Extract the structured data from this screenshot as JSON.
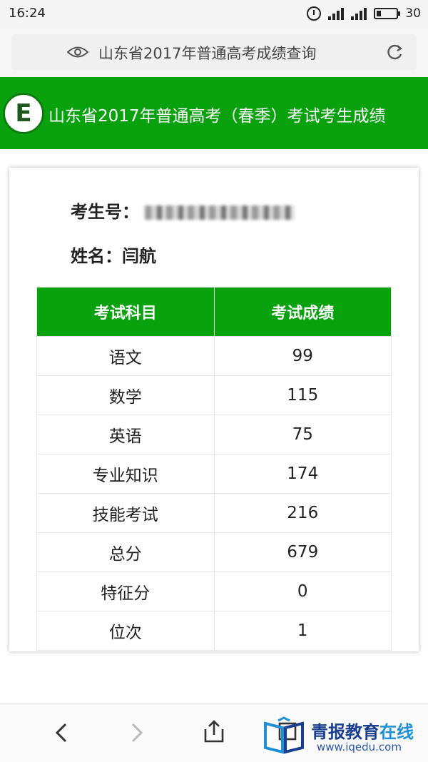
{
  "status_bar": {
    "time": "16:24",
    "battery": "30"
  },
  "browser": {
    "page_title": "山东省2017年普通高考成绩查询"
  },
  "header": {
    "logo_letter": "E",
    "title": "山东省2017年普通高考（春季）考试考生成绩"
  },
  "student": {
    "exam_no_label": "考生号：",
    "name_label": "姓名：",
    "name": "闫航"
  },
  "table": {
    "headers": [
      "考试科目",
      "考试成绩"
    ],
    "rows": [
      {
        "subject": "语文",
        "score": "99"
      },
      {
        "subject": "数学",
        "score": "115"
      },
      {
        "subject": "英语",
        "score": "75"
      },
      {
        "subject": "专业知识",
        "score": "174"
      },
      {
        "subject": "技能考试",
        "score": "216"
      },
      {
        "subject": "总分",
        "score": "679"
      },
      {
        "subject": "特征分",
        "score": "0"
      },
      {
        "subject": "位次",
        "score": "1"
      }
    ]
  },
  "watermark": {
    "name_part1": "青报教育",
    "name_part2": "在线",
    "url": "www.iqedu.com"
  },
  "colors": {
    "header_green": "#0aa10f",
    "watermark_blue": "#1a3f8f"
  }
}
